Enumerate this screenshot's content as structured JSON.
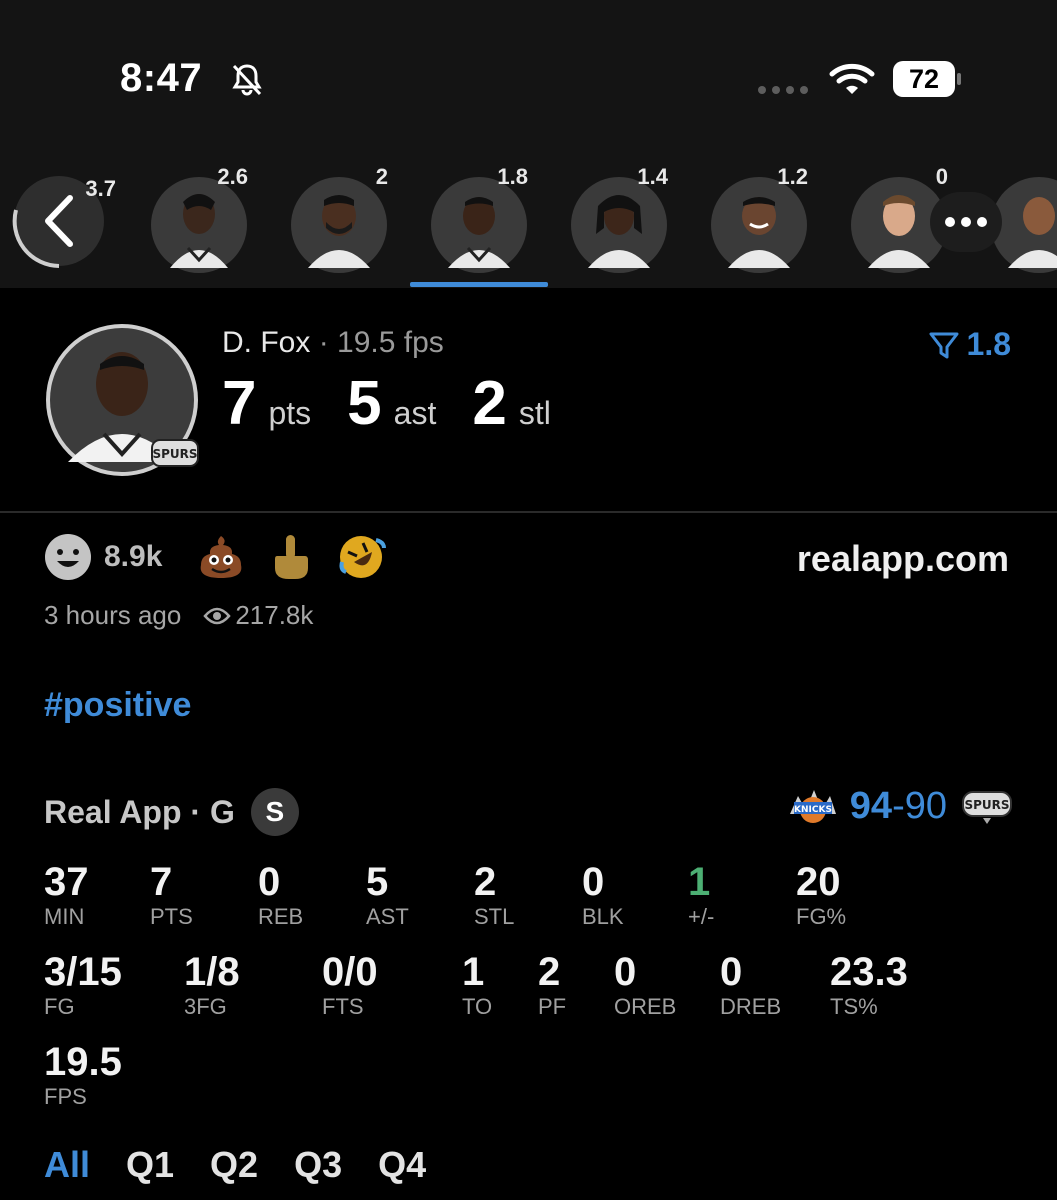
{
  "status_bar": {
    "time": "8:47",
    "battery": "72"
  },
  "player_strip": {
    "scores": [
      "3.7",
      "2.6",
      "2",
      "1.8",
      "1.4",
      "1.2",
      "0"
    ],
    "selected_index": 3
  },
  "player": {
    "name": "D. Fox",
    "separator": " · ",
    "fps": "19.5 fps",
    "pts_value": "7",
    "pts_unit": "pts",
    "ast_value": "5",
    "ast_unit": "ast",
    "stl_value": "2",
    "stl_unit": "stl",
    "rank_value": "1.8"
  },
  "reactions": {
    "count": "8.9k",
    "site": "realapp.com",
    "time_ago": "3 hours ago",
    "views": "217.8k"
  },
  "hashtag": "#positive",
  "game": {
    "label": "Real App · G",
    "badge": "S",
    "score_home": "94",
    "score_dash": "-",
    "score_away": "90"
  },
  "stats": {
    "row1": [
      {
        "value": "37",
        "label": "MIN"
      },
      {
        "value": "7",
        "label": "PTS"
      },
      {
        "value": "0",
        "label": "REB"
      },
      {
        "value": "5",
        "label": "AST"
      },
      {
        "value": "2",
        "label": "STL"
      },
      {
        "value": "0",
        "label": "BLK"
      },
      {
        "value": "1",
        "label": "+/-"
      },
      {
        "value": "20",
        "label": "FG%"
      }
    ],
    "row2": [
      {
        "value": "3/15",
        "label": "FG"
      },
      {
        "value": "1/8",
        "label": "3FG"
      },
      {
        "value": "0/0",
        "label": "FTS"
      },
      {
        "value": "1",
        "label": "TO"
      },
      {
        "value": "2",
        "label": "PF"
      },
      {
        "value": "0",
        "label": "OREB"
      },
      {
        "value": "0",
        "label": "DREB"
      },
      {
        "value": "23.3",
        "label": "TS%"
      }
    ],
    "row3": [
      {
        "value": "19.5",
        "label": "FPS"
      }
    ]
  },
  "tabs": [
    "All",
    "Q1",
    "Q2",
    "Q3",
    "Q4"
  ],
  "colors": {
    "accent": "#3f8bd8",
    "positive": "#4caf73",
    "background": "#000000",
    "strip_bg": "#141414"
  }
}
